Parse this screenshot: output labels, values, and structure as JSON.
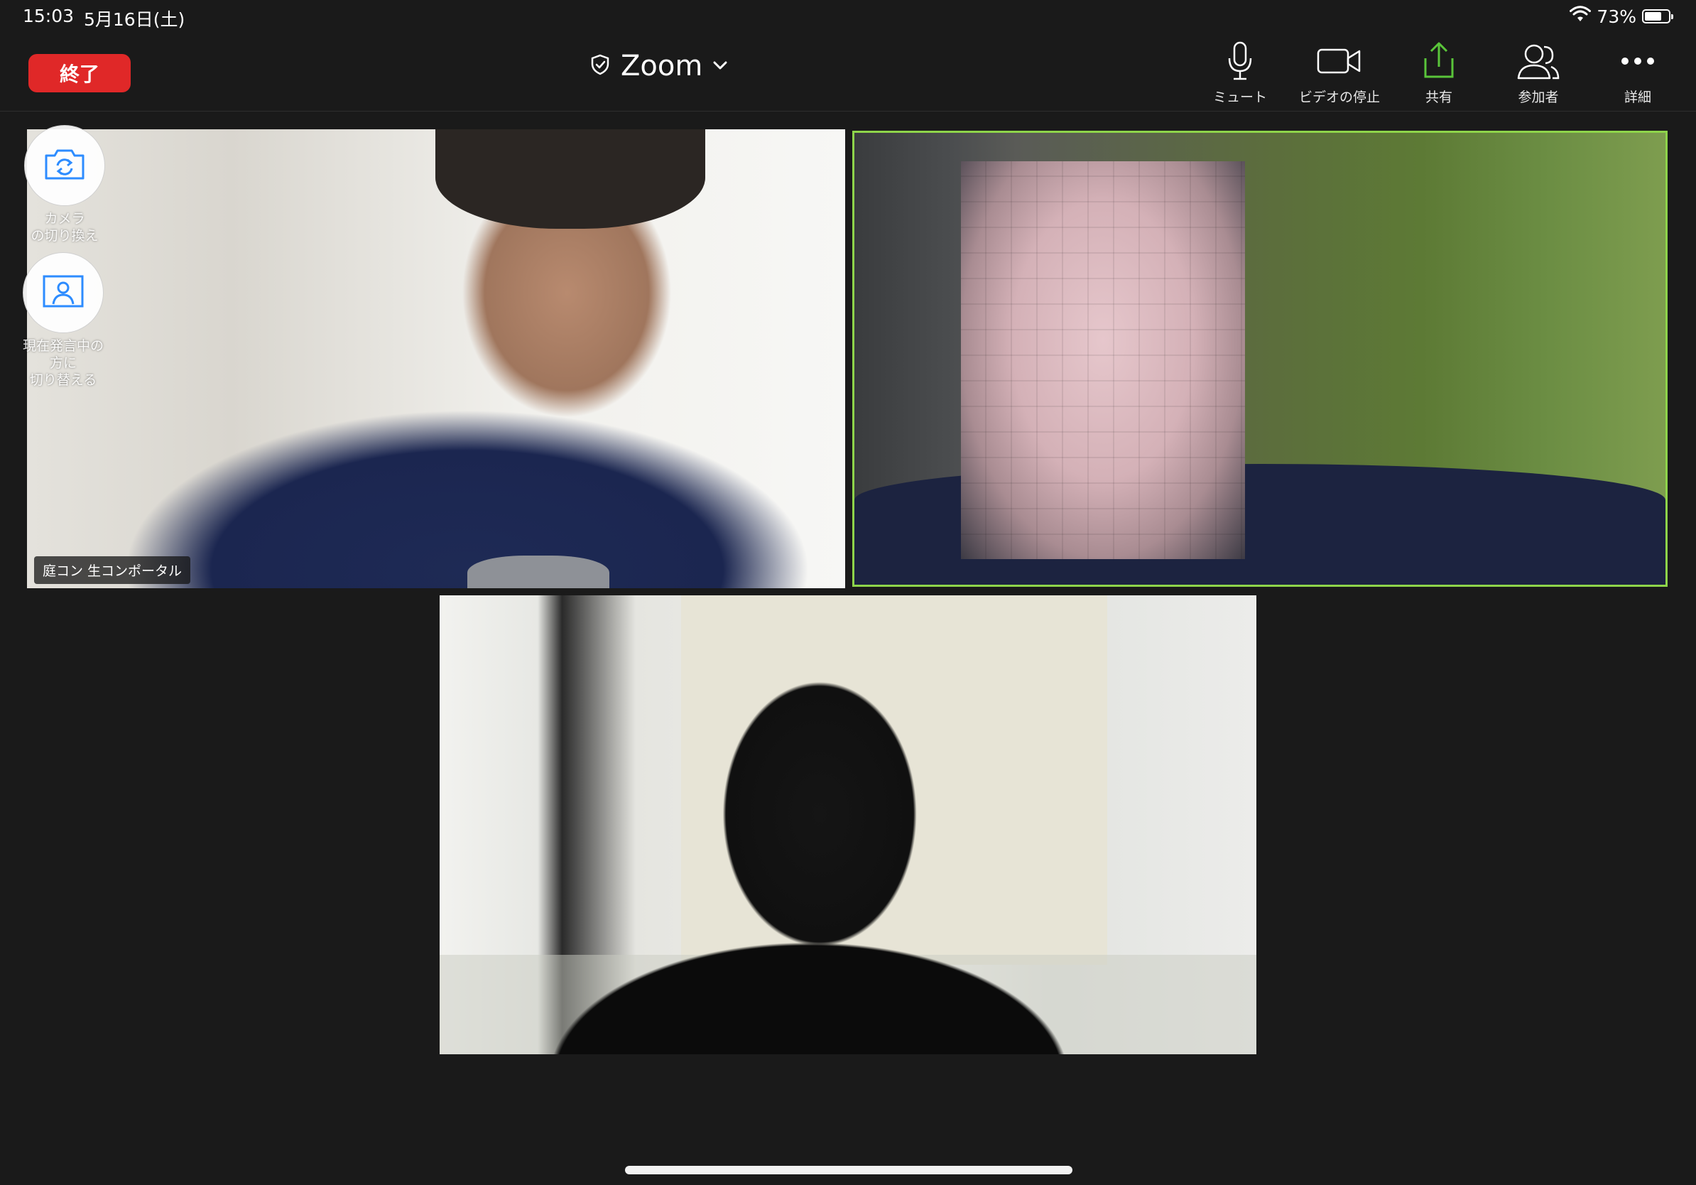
{
  "status_bar": {
    "time": "15:03",
    "date": "5月16日(土)",
    "battery": "73%",
    "battery_level": 0.73
  },
  "toolbar": {
    "end_label": "終了",
    "meeting_title": "Zoom",
    "buttons": [
      {
        "label": "ミュート",
        "icon": "microphone-icon"
      },
      {
        "label": "ビデオの停止",
        "icon": "video-camera-icon"
      },
      {
        "label": "共有",
        "icon": "share-upload-icon"
      },
      {
        "label": "参加者",
        "icon": "participants-icon"
      },
      {
        "label": "詳細",
        "icon": "more-dots-icon"
      }
    ]
  },
  "overlay": {
    "switch_camera_label": "カメラ\nの切り換え",
    "switch_speaker_label": "現在発言中の\n方に\n切り替える"
  },
  "tiles": [
    {
      "name": "庭コン 生コンポータル"
    }
  ],
  "colors": {
    "end_button": "#e02828",
    "active_speaker_border": "#8ed44a",
    "share_icon": "#5ac53a",
    "icon_blue": "#2d8cff"
  }
}
